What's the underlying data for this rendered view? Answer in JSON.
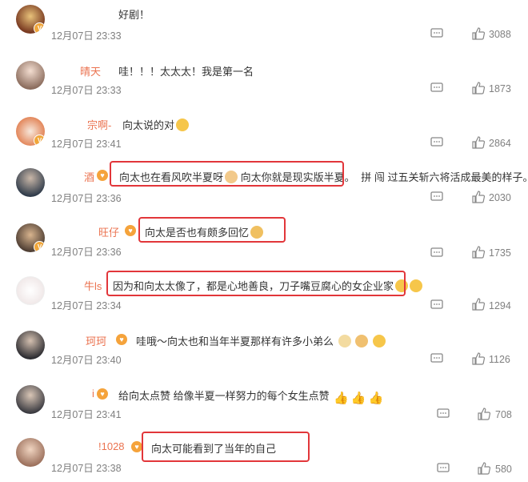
{
  "colors": {
    "username": "#eb7350",
    "highlight": "#e2363a",
    "meta": "#808080",
    "badge": "#f0a63a"
  },
  "comments": [
    {
      "username": "",
      "text": "好剧！",
      "time": "12月07日 23:33",
      "likes": "3088",
      "highlighted": false,
      "emojis": []
    },
    {
      "username": "晴天",
      "text": "哇！！！太太太！我是第一名",
      "time": "12月07日 23:33",
      "likes": "1873",
      "highlighted": false,
      "emojis": []
    },
    {
      "username": "宗啊-",
      "text": "向太说的对",
      "time": "12月07日 23:41",
      "likes": "2864",
      "highlighted": false,
      "emojis": [
        "heart-eyes-emoji"
      ]
    },
    {
      "username": "酒",
      "text": "向太也在看风吹半夏呀",
      "text2": "向太你就是现实版半夏。",
      "text3": "拼 闯 过五关斩六将活成最美的样子。",
      "time": "12月07日 23:36",
      "likes": "2030",
      "highlighted": true,
      "emojis": [
        "handshake-emoji"
      ]
    },
    {
      "username": "旺仔",
      "text": "向太是否也有颇多回忆",
      "time": "12月07日 23:36",
      "likes": "1735",
      "highlighted": true,
      "emojis": [
        "thinking-emoji"
      ]
    },
    {
      "username": "牛ls",
      "text": "因为和向太太像了，都是心地善良，刀子嘴豆腐心的女企业家",
      "time": "12月07日 23:34",
      "likes": "1294",
      "highlighted": true,
      "emojis": [
        "laugh-emoji",
        "laugh-emoji"
      ]
    },
    {
      "username": "珂珂",
      "text": "哇哦～向太也和当年半夏那样有许多小弟么",
      "time": "12月07日 23:40",
      "likes": "1126",
      "highlighted": false,
      "emojis": [
        "doge-emoji",
        "pray-emoji",
        "sunglasses-emoji"
      ]
    },
    {
      "username": "i",
      "text": "给向太点赞 给像半夏一样努力的每个女生点赞",
      "time": "12月07日 23:41",
      "likes": "708",
      "highlighted": false,
      "emojis": [
        "thumbs-up-emoji",
        "thumbs-up-emoji",
        "thumbs-up-emoji"
      ]
    },
    {
      "username": "!1028",
      "text": "向太可能看到了当年的自己",
      "time": "12月07日 23:38",
      "likes": "580",
      "highlighted": true,
      "emojis": []
    }
  ]
}
